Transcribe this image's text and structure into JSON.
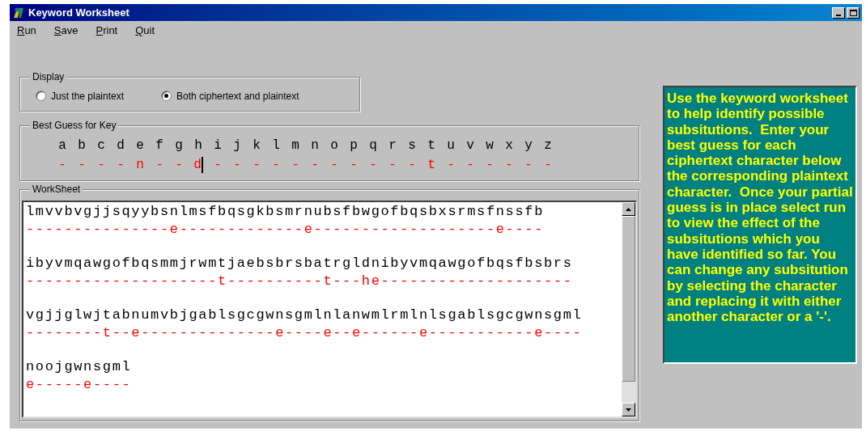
{
  "window": {
    "title": "Keyword Worksheet"
  },
  "menu": [
    {
      "label": "Run"
    },
    {
      "label": "Save"
    },
    {
      "label": "Print"
    },
    {
      "label": "Quit"
    }
  ],
  "display": {
    "title": "Display",
    "options": [
      {
        "label": "Just the plaintext",
        "selected": false
      },
      {
        "label": "Both ciphertext and plaintext",
        "selected": true
      }
    ]
  },
  "key": {
    "title": "Best Guess for Key",
    "letters": [
      {
        "plain": "a",
        "guess": "-",
        "caret": false
      },
      {
        "plain": "b",
        "guess": "-",
        "caret": false
      },
      {
        "plain": "c",
        "guess": "-",
        "caret": false
      },
      {
        "plain": "d",
        "guess": "-",
        "caret": false
      },
      {
        "plain": "e",
        "guess": "n",
        "caret": false
      },
      {
        "plain": "f",
        "guess": "-",
        "caret": false
      },
      {
        "plain": "g",
        "guess": "-",
        "caret": false
      },
      {
        "plain": "h",
        "guess": "d",
        "caret": true
      },
      {
        "plain": "i",
        "guess": "-",
        "caret": false
      },
      {
        "plain": "j",
        "guess": "-",
        "caret": false
      },
      {
        "plain": "k",
        "guess": "-",
        "caret": false
      },
      {
        "plain": "l",
        "guess": "-",
        "caret": false
      },
      {
        "plain": "m",
        "guess": "-",
        "caret": false
      },
      {
        "plain": "n",
        "guess": "-",
        "caret": false
      },
      {
        "plain": "o",
        "guess": "-",
        "caret": false
      },
      {
        "plain": "p",
        "guess": "-",
        "caret": false
      },
      {
        "plain": "q",
        "guess": "-",
        "caret": false
      },
      {
        "plain": "r",
        "guess": "-",
        "caret": false
      },
      {
        "plain": "s",
        "guess": "-",
        "caret": false
      },
      {
        "plain": "t",
        "guess": "t",
        "caret": false
      },
      {
        "plain": "u",
        "guess": "-",
        "caret": false
      },
      {
        "plain": "v",
        "guess": "-",
        "caret": false
      },
      {
        "plain": "w",
        "guess": "-",
        "caret": false
      },
      {
        "plain": "x",
        "guess": "-",
        "caret": false
      },
      {
        "plain": "y",
        "guess": "-",
        "caret": false
      },
      {
        "plain": "z",
        "guess": "-",
        "caret": false
      }
    ]
  },
  "worksheet": {
    "title": "WorkSheet",
    "lines": [
      {
        "ciphertext": "lmvvbvgjjsqyybsnlmsfbqsgkbsmrnubsfbwgofbqsbxsrmsfnssfb",
        "plaintext": "---------------e-------------e-------------------e----"
      },
      {
        "ciphertext": "ibyvmqawgofbqsmmjrwmtjaebsbrsbatrgldnibyvmqawgofbqsfbsbrs",
        "plaintext": "--------------------t----------t---he--------------------"
      },
      {
        "ciphertext": "vgjjglwjtabnumvbjgablsgcgwnsgmlnlanwmlrmlnlsgablsgcgwnsgml",
        "plaintext": "--------t--e--------------e----e--e------e-----------e----"
      },
      {
        "ciphertext": "noojgwnsgml",
        "plaintext": "e-----e----"
      }
    ]
  },
  "help": {
    "text": "Use the keyword worksheet to help identify possible subsitutions.  Enter your best guess for each ciphertext character below the corresponding plaintext character.  Once your partial guess is in place select run to view the effect of the subsitutions which you have identified so far. You can change any subsitution by selecting the character and replacing it with either another character or a '-'."
  }
}
